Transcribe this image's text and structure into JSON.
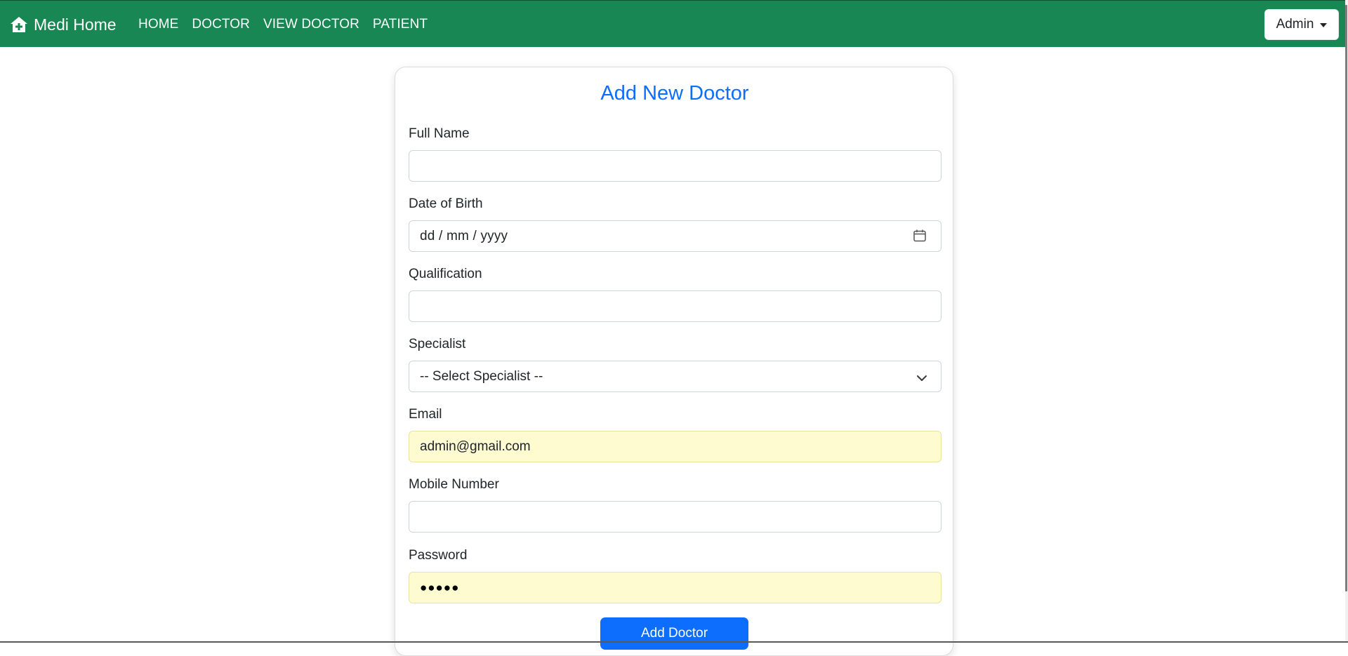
{
  "navbar": {
    "brand": "Medi Home",
    "brand_icon": "house-medical-icon",
    "links": [
      "HOME",
      "DOCTOR",
      "VIEW DOCTOR",
      "PATIENT"
    ],
    "user_menu_label": "Admin"
  },
  "form": {
    "title": "Add New Doctor",
    "full_name_label": "Full Name",
    "full_name_value": "",
    "dob_label": "Date of Birth",
    "dob_placeholder": "dd / mm / yyyy",
    "qualification_label": "Qualification",
    "qualification_value": "",
    "specialist_label": "Specialist",
    "specialist_selected": "-- Select Specialist --",
    "email_label": "Email",
    "email_value": "admin@gmail.com",
    "mobile_label": "Mobile Number",
    "mobile_value": "",
    "password_label": "Password",
    "password_mask": "●●●●●",
    "submit_label": "Add Doctor"
  },
  "colors": {
    "navbar_bg": "#198754",
    "accent": "#0d6efd",
    "autofill_bg": "#fefbd1"
  }
}
